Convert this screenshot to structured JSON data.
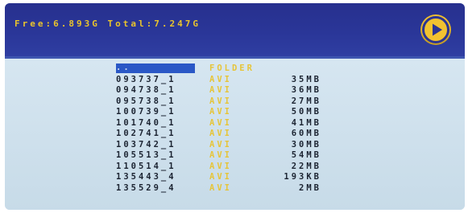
{
  "header": {
    "storage_text": "Free:6.893G Total:7.247G",
    "play_icon": "play-icon"
  },
  "colors": {
    "header_bg": "#2a3698",
    "accent_yellow": "#f2c230",
    "list_bg": "#c9dcea",
    "selection": "#2a58c6"
  },
  "files": [
    {
      "name": "..",
      "type": "FOLDER",
      "size": "",
      "selected": true
    },
    {
      "name": "093737_1",
      "type": "AVI",
      "size": "35MB"
    },
    {
      "name": "094738_1",
      "type": "AVI",
      "size": "36MB"
    },
    {
      "name": "095738_1",
      "type": "AVI",
      "size": "27MB"
    },
    {
      "name": "100739_1",
      "type": "AVI",
      "size": "50MB"
    },
    {
      "name": "101740_1",
      "type": "AVI",
      "size": "41MB"
    },
    {
      "name": "102741_1",
      "type": "AVI",
      "size": "60MB"
    },
    {
      "name": "103742_1",
      "type": "AVI",
      "size": "30MB"
    },
    {
      "name": "105513_1",
      "type": "AVI",
      "size": "54MB"
    },
    {
      "name": "110514_1",
      "type": "AVI",
      "size": "22MB"
    },
    {
      "name": "135443_4",
      "type": "AVI",
      "size": "193KB"
    },
    {
      "name": "135529_4",
      "type": "AVI",
      "size": "2MB"
    }
  ]
}
